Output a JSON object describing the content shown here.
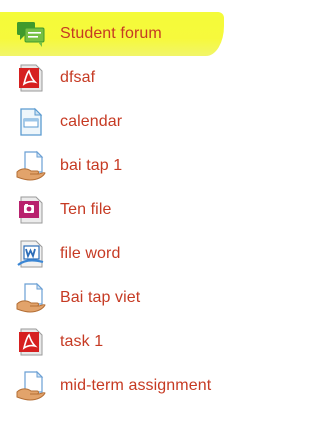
{
  "activities": [
    {
      "label": "Student forum",
      "icon": "forum-icon",
      "highlighted": true
    },
    {
      "label": "dfsaf",
      "icon": "pdf-icon"
    },
    {
      "label": "calendar",
      "icon": "document-icon"
    },
    {
      "label": "bai tap 1",
      "icon": "assignment-icon"
    },
    {
      "label": "Ten file",
      "icon": "image-file-icon"
    },
    {
      "label": "file word",
      "icon": "word-icon"
    },
    {
      "label": "Bai tap viet",
      "icon": "assignment-icon"
    },
    {
      "label": "task 1",
      "icon": "pdf-icon"
    },
    {
      "label": "mid-term assignment",
      "icon": "assignment-icon"
    }
  ],
  "colors": {
    "link": "#c63a23",
    "highlight": "#f4fb39"
  }
}
